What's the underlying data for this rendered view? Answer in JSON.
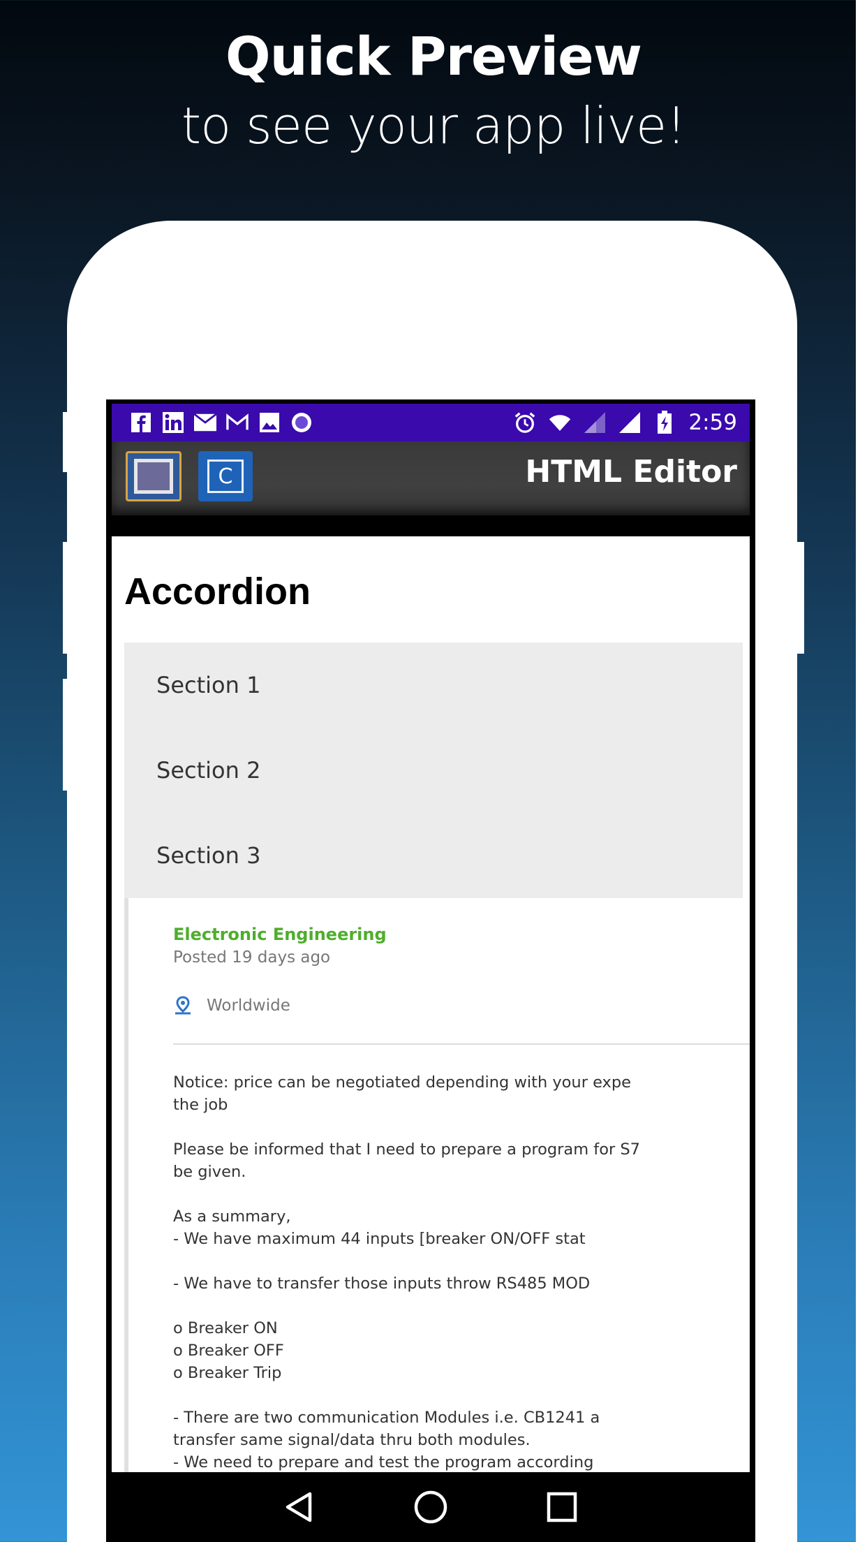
{
  "promo": {
    "title": "Quick Preview",
    "subtitle": "to see your app live!"
  },
  "statusbar": {
    "time": "2:59",
    "left_icons": [
      "facebook-icon",
      "linkedin-icon",
      "email-icon",
      "gmail-icon",
      "image-icon",
      "record-icon"
    ],
    "right_icons": [
      "alarm-icon",
      "wifi-icon",
      "signal-icon",
      "signal-icon",
      "battery-icon"
    ]
  },
  "toolbar": {
    "button1_label": "",
    "button2_label": "C",
    "title": "HTML Editor"
  },
  "page": {
    "title": "Accordion",
    "sections": [
      "Section 1",
      "Section 2",
      "Section 3"
    ]
  },
  "job": {
    "category": "Electronic Engineering",
    "posted": "Posted 19 days ago",
    "location": "Worldwide",
    "lines": [
      "Notice: price can be negotiated depending with your expe",
      "the job",
      "",
      "Please be informed that I need to prepare a program for S7",
      "be given.",
      "",
      "As a summary,",
      "-          We have maximum 44 inputs [breaker ON/OFF stat",
      "",
      "-          We have to transfer those inputs throw RS485 MOD",
      "",
      "o   Breaker ON",
      "o   Breaker OFF",
      "o   Breaker Trip",
      "",
      "-          There are two communication Modules i.e. CB1241 a",
      "transfer same signal/data thru both modules.",
      "-          We need to prepare and test the program according"
    ]
  },
  "colors": {
    "statusbar": "#3a0aac",
    "toolbar": "#3d3d3d",
    "category_green": "#4fae2c",
    "accordion_bg": "#ececec"
  }
}
